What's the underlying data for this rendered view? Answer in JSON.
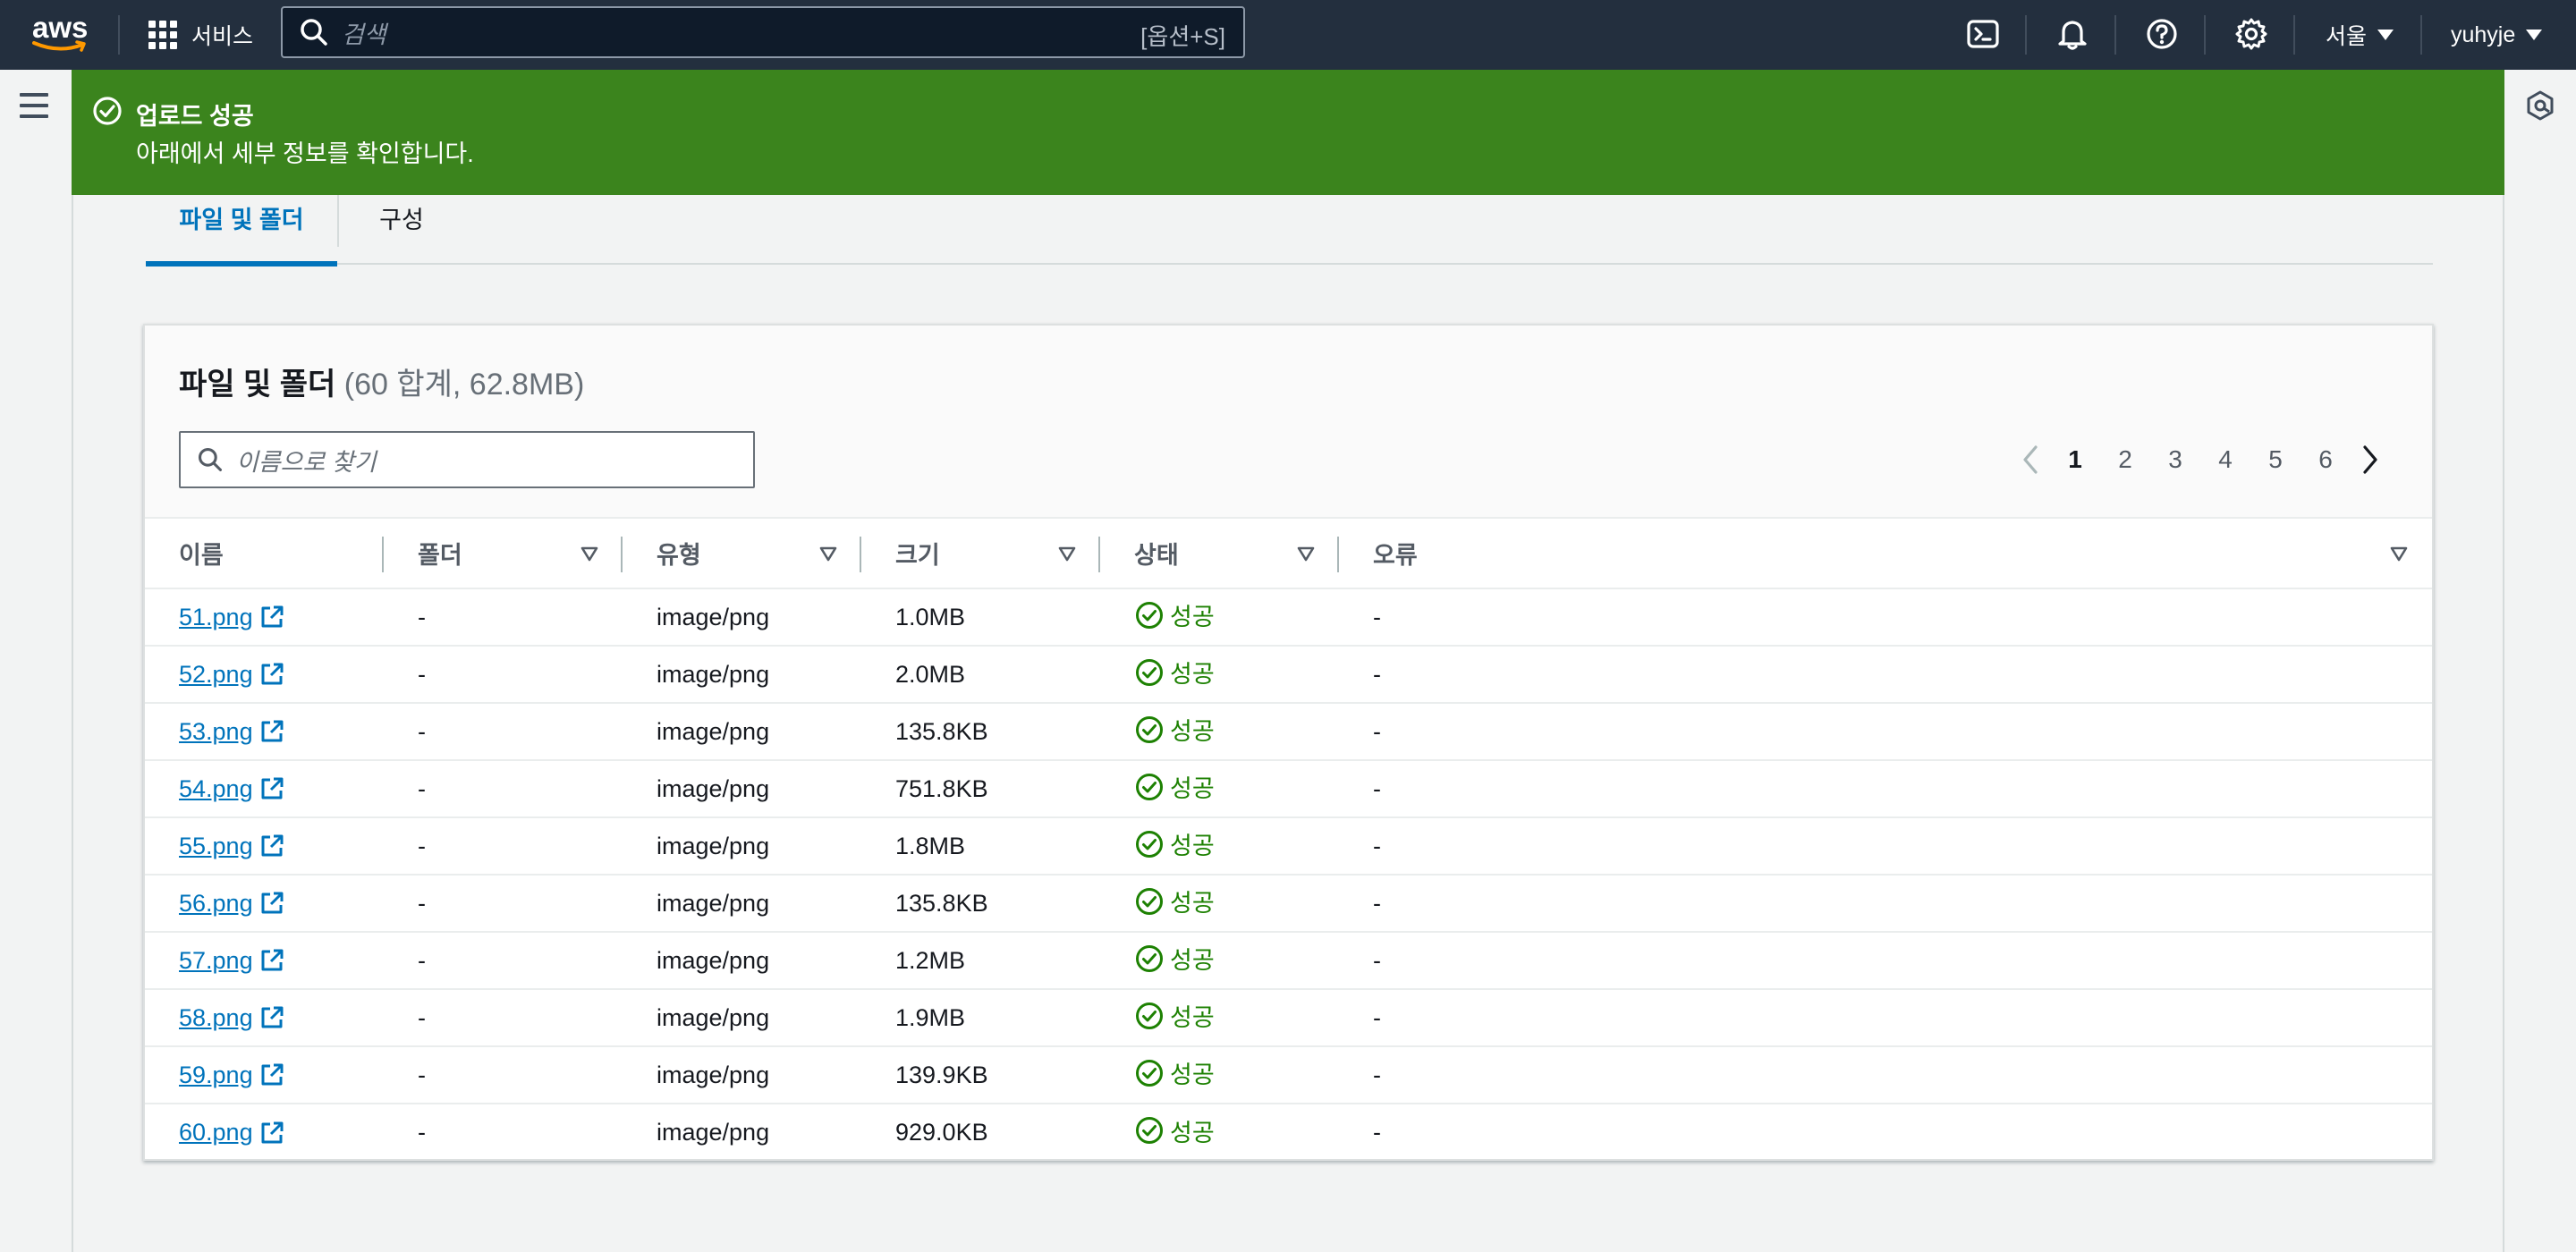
{
  "nav": {
    "logo": "aws",
    "services_label": "서비스",
    "search_placeholder": "검색",
    "search_shortcut": "[옵션+S]",
    "region": "서울",
    "user": "yuhyje"
  },
  "flash": {
    "title": "업로드 성공",
    "description": "아래에서 세부 정보를 확인합니다."
  },
  "tabs": [
    {
      "label": "파일 및 폴더",
      "active": true
    },
    {
      "label": "구성",
      "active": false
    }
  ],
  "files_panel": {
    "title": "파일 및 폴더",
    "counter": "(60 합계, 62.8MB)",
    "filter_placeholder": "이름으로 찾기",
    "pages": [
      "1",
      "2",
      "3",
      "4",
      "5",
      "6"
    ],
    "current_page": "1",
    "columns": [
      "이름",
      "폴더",
      "유형",
      "크기",
      "상태",
      "오류"
    ],
    "rows": [
      {
        "name": "51.png",
        "folder": "-",
        "type": "image/png",
        "size": "1.0MB",
        "status": "성공",
        "error": "-"
      },
      {
        "name": "52.png",
        "folder": "-",
        "type": "image/png",
        "size": "2.0MB",
        "status": "성공",
        "error": "-"
      },
      {
        "name": "53.png",
        "folder": "-",
        "type": "image/png",
        "size": "135.8KB",
        "status": "성공",
        "error": "-"
      },
      {
        "name": "54.png",
        "folder": "-",
        "type": "image/png",
        "size": "751.8KB",
        "status": "성공",
        "error": "-"
      },
      {
        "name": "55.png",
        "folder": "-",
        "type": "image/png",
        "size": "1.8MB",
        "status": "성공",
        "error": "-"
      },
      {
        "name": "56.png",
        "folder": "-",
        "type": "image/png",
        "size": "135.8KB",
        "status": "성공",
        "error": "-"
      },
      {
        "name": "57.png",
        "folder": "-",
        "type": "image/png",
        "size": "1.2MB",
        "status": "성공",
        "error": "-"
      },
      {
        "name": "58.png",
        "folder": "-",
        "type": "image/png",
        "size": "1.9MB",
        "status": "성공",
        "error": "-"
      },
      {
        "name": "59.png",
        "folder": "-",
        "type": "image/png",
        "size": "139.9KB",
        "status": "성공",
        "error": "-"
      },
      {
        "name": "60.png",
        "folder": "-",
        "type": "image/png",
        "size": "929.0KB",
        "status": "성공",
        "error": "-"
      }
    ]
  },
  "colors": {
    "nav_bg": "#232f3e",
    "success_banner": "#3b841d",
    "link": "#0073bb",
    "success_text": "#1d8102"
  }
}
